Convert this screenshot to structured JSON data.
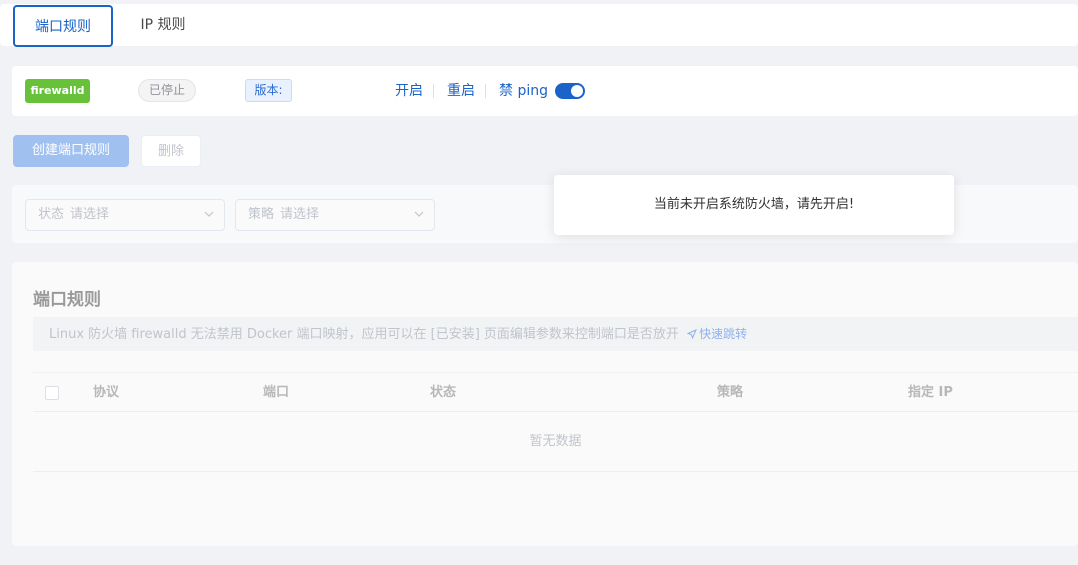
{
  "tabs": {
    "port_rules": "端口规则",
    "ip_rules": "IP 规则"
  },
  "status": {
    "service_name": "firewalld",
    "state": "已停止",
    "version_label": "版本:",
    "actions": {
      "start": "开启",
      "restart": "重启",
      "ban_ping": "禁 ping"
    },
    "ban_ping_enabled": true
  },
  "buttons": {
    "create": "创建端口规则",
    "delete": "删除"
  },
  "filters": {
    "status_label": "状态",
    "status_placeholder": "请选择",
    "policy_label": "策略",
    "policy_placeholder": "请选择"
  },
  "notice": "当前未开启系统防火墙，请先开启!",
  "panel": {
    "title": "端口规则",
    "info": "Linux 防火墙 firewalld 无法禁用 Docker 端口映射，应用可以在 [已安装] 页面编辑参数来控制端口是否放开",
    "jump_link": "快速跳转",
    "table": {
      "columns": [
        "协议",
        "端口",
        "状态",
        "策略",
        "指定 IP"
      ],
      "empty_text": "暂无数据"
    }
  },
  "colors": {
    "primary": "#1a63c9",
    "success": "#67c23a"
  }
}
